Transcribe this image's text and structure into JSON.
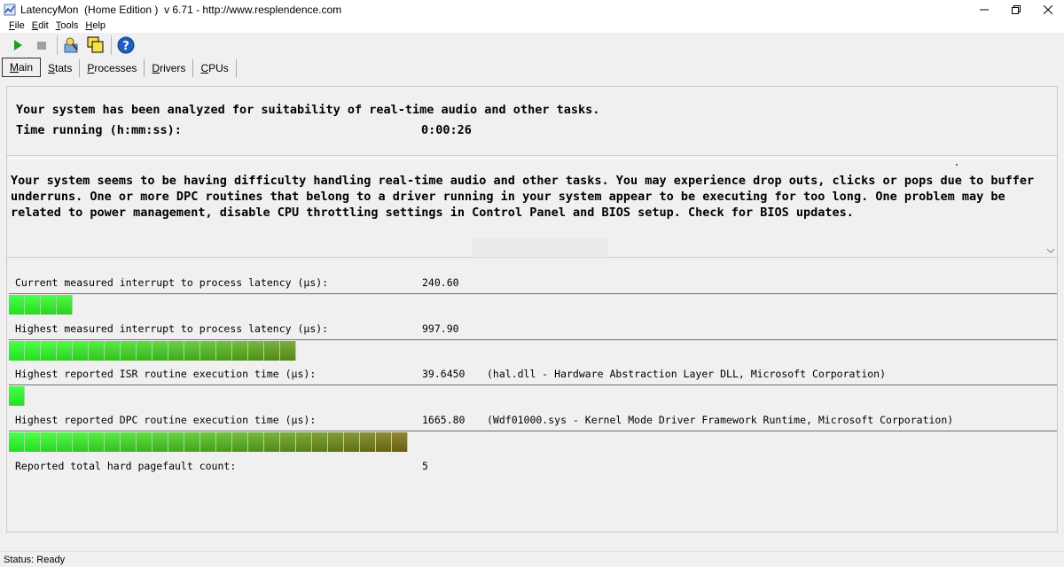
{
  "window": {
    "title": "LatencyMon  (Home Edition )  v 6.71 - http://www.resplendence.com",
    "icon": "latencymon-app-icon"
  },
  "menu": [
    {
      "mnemonic": "F",
      "rest": "ile"
    },
    {
      "mnemonic": "E",
      "rest": "dit"
    },
    {
      "mnemonic": "T",
      "rest": "ools"
    },
    {
      "mnemonic": "H",
      "rest": "elp"
    }
  ],
  "toolbar": {
    "icons": [
      "play-icon",
      "stop-icon",
      "analyze-drivers-icon",
      "window-overlay-icon",
      "help-icon"
    ],
    "colors": {
      "play": "#1ea01e",
      "stop": "#a0a0a0",
      "help": "#1f5fbf"
    }
  },
  "tabs": [
    {
      "mnemonic": "M",
      "rest": "ain"
    },
    {
      "mnemonic": "S",
      "rest": "tats"
    },
    {
      "mnemonic": "P",
      "rest": "rocesses"
    },
    {
      "mnemonic": "D",
      "rest": "rivers"
    },
    {
      "mnemonic": "C",
      "rest": "PUs"
    }
  ],
  "summary": {
    "analyzed": "Your system has been analyzed for suitability of real-time audio and other tasks.",
    "time_label": "Time running (h:mm:ss):",
    "time_value": "0:00:26"
  },
  "conclusion": "Your system seems to be having difficulty handling real-time audio and other tasks. You may experience drop outs, clicks or pops due to buffer underruns. One or more DPC routines that belong to a driver running in your system appear to be executing for too long. One problem may be related to power management, disable CPU throttling settings in Control Panel and BIOS setup. Check for BIOS updates.",
  "metrics": [
    {
      "label": "Current measured interrupt to process latency (µs):",
      "value": "240.60",
      "extra": "",
      "segments": 4
    },
    {
      "label": "Highest measured interrupt to process latency (µs):",
      "value": "997.90",
      "extra": "",
      "segments": 18
    },
    {
      "label": "Highest reported ISR routine execution time (µs):",
      "value": "39.6450",
      "extra": "(hal.dll - Hardware Abstraction Layer DLL, Microsoft Corporation)",
      "segments": 1
    },
    {
      "label": "Highest reported DPC routine execution time (µs):",
      "value": "1665.80",
      "extra": "(Wdf01000.sys - Kernel Mode Driver Framework Runtime, Microsoft Corporation)",
      "segments": 25
    }
  ],
  "pagefault": {
    "label": "Reported total hard pagefault count:",
    "value": "5"
  },
  "bar_colors": {
    "start": "#22e022",
    "end": "#6b5a10"
  },
  "status": "Status: Ready"
}
